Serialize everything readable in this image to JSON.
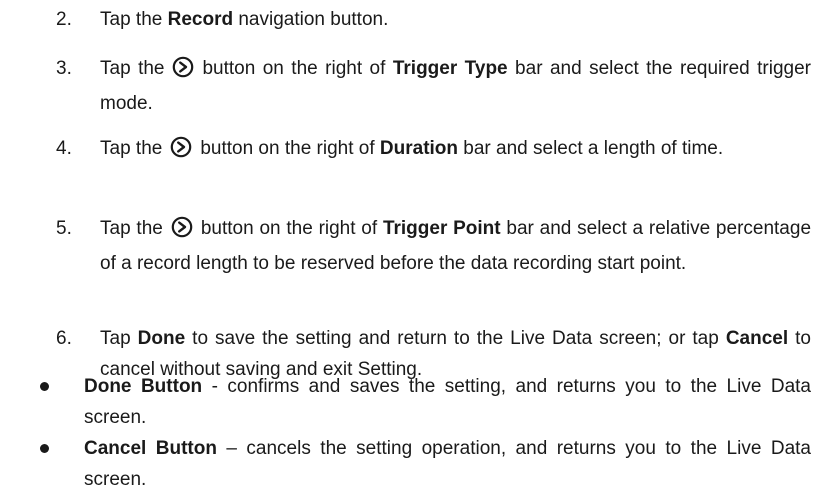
{
  "steps": [
    {
      "number": "2.",
      "text_before": "Tap the ",
      "bold": "Record",
      "text_after": " navigation button."
    },
    {
      "number": "3.",
      "before": "Tap the",
      "icon": "circle-chevron-right-icon",
      "after_icon": "button on the right of ",
      "bold": "Trigger Type",
      "rest": " bar and select the required trigger mode."
    },
    {
      "number": "4.",
      "before": "Tap the",
      "icon": "circle-chevron-right-icon",
      "after_icon": "button on the right of ",
      "bold": "Duration",
      "rest": " bar and select a length of time."
    },
    {
      "number": "5.",
      "before": "Tap the",
      "icon": "circle-chevron-right-icon",
      "after_icon": "button on the right of ",
      "bold": "Trigger Point",
      "rest": " bar and select a relative percentage of a record length to be reserved before the data recording start point."
    },
    {
      "number": "6.",
      "part1": "Tap ",
      "bold1": "Done",
      "part2": " to save the setting and return to the Live Data screen; or tap ",
      "bold2": "Cancel",
      "part3": " to cancel without saving and exit Setting."
    }
  ],
  "bullets": [
    {
      "bold": "Done Button",
      "text": " - confirms and saves the setting, and returns you to the Live Data screen."
    },
    {
      "bold": "Cancel Button",
      "text": " – cancels the setting operation, and returns you to the Live Data screen."
    }
  ]
}
